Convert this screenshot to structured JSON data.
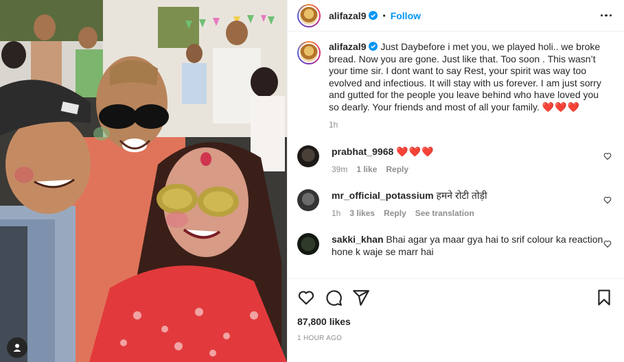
{
  "post": {
    "username": "alifazal9",
    "follow_label": "Follow",
    "separator": "•",
    "caption": {
      "username": "alifazal9",
      "text": "Just Daybefore i met you, we played holi.. we broke bread. Now you are gone. Just like that. Too soon . This wasn’t your time sir. I dont want to say Rest, your spirit was way too evolved and infectious. It will stay with us forever. I am just sorry and gutted for the people you leave behind who have loved you so dearly. Your friends and most of all your family.",
      "emoji": "❤️❤️❤️",
      "age": "1h"
    },
    "comments": [
      {
        "username": "prabhat_9968",
        "text": "",
        "emoji": "❤️❤️❤️",
        "age": "39m",
        "likes": "1 like",
        "reply": "Reply",
        "translate": ""
      },
      {
        "username": "mr_official_potassium",
        "text": "हमने रोटी तोड़ी",
        "emoji": "",
        "age": "1h",
        "likes": "3 likes",
        "reply": "Reply",
        "translate": "See translation"
      },
      {
        "username": "sakki_khan",
        "text": "Bhai agar ya maar gya hai to srif colour ka reaction hone k waje se marr hai",
        "emoji": "",
        "age": "",
        "likes": "",
        "reply": "",
        "translate": ""
      }
    ],
    "likes_count": "87,800 likes",
    "timestamp": "1 HOUR AGO"
  },
  "icons": {
    "verified": "verified-badge-icon",
    "more": "more-options-icon",
    "like": "heart-icon",
    "comment": "comment-bubble-icon",
    "share": "paper-plane-icon",
    "save": "bookmark-icon",
    "tag": "user-tag-icon"
  },
  "colors": {
    "accent": "#0095f6",
    "verified": "#0095f6",
    "secondary_text": "#8e8e8e",
    "heart": "#e0245e"
  }
}
